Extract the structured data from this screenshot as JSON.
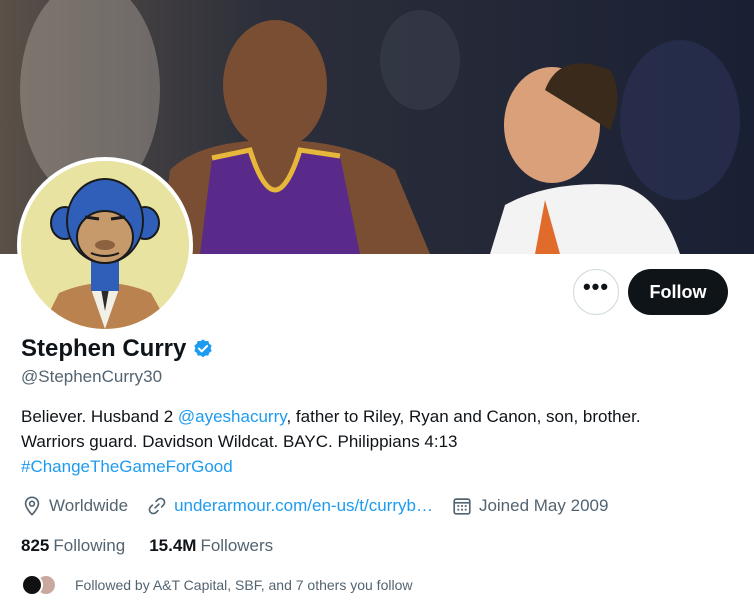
{
  "profile": {
    "display_name": "Stephen Curry",
    "handle": "@StephenCurry30",
    "bio": {
      "part1": "Believer. Husband 2 ",
      "mention": "@ayeshacurry",
      "part2": ", father to Riley, Ryan and Canon, son, brother.",
      "line2": "Warriors guard. Davidson Wildcat. BAYC. Philippians 4:13",
      "hashtag": "#ChangeTheGameForGood"
    },
    "location": "Worldwide",
    "website": "underarmour.com/en-us/t/curryb…",
    "joined": "Joined May 2009",
    "following_count": "825",
    "following_label": "Following",
    "followers_count": "15.4M",
    "followers_label": "Followers",
    "followed_by": "Followed by A&T Capital, SBF, and 7 others you follow"
  },
  "actions": {
    "more_label": "•••",
    "follow_label": "Follow"
  },
  "icons": {
    "verified": "verified-badge-icon",
    "location": "location-pin-icon",
    "link": "link-icon",
    "calendar": "calendar-icon",
    "more": "more-options-icon"
  },
  "colors": {
    "accent": "#1d9bf0",
    "follow_button": "#0f1419",
    "secondary_text": "#536471"
  }
}
